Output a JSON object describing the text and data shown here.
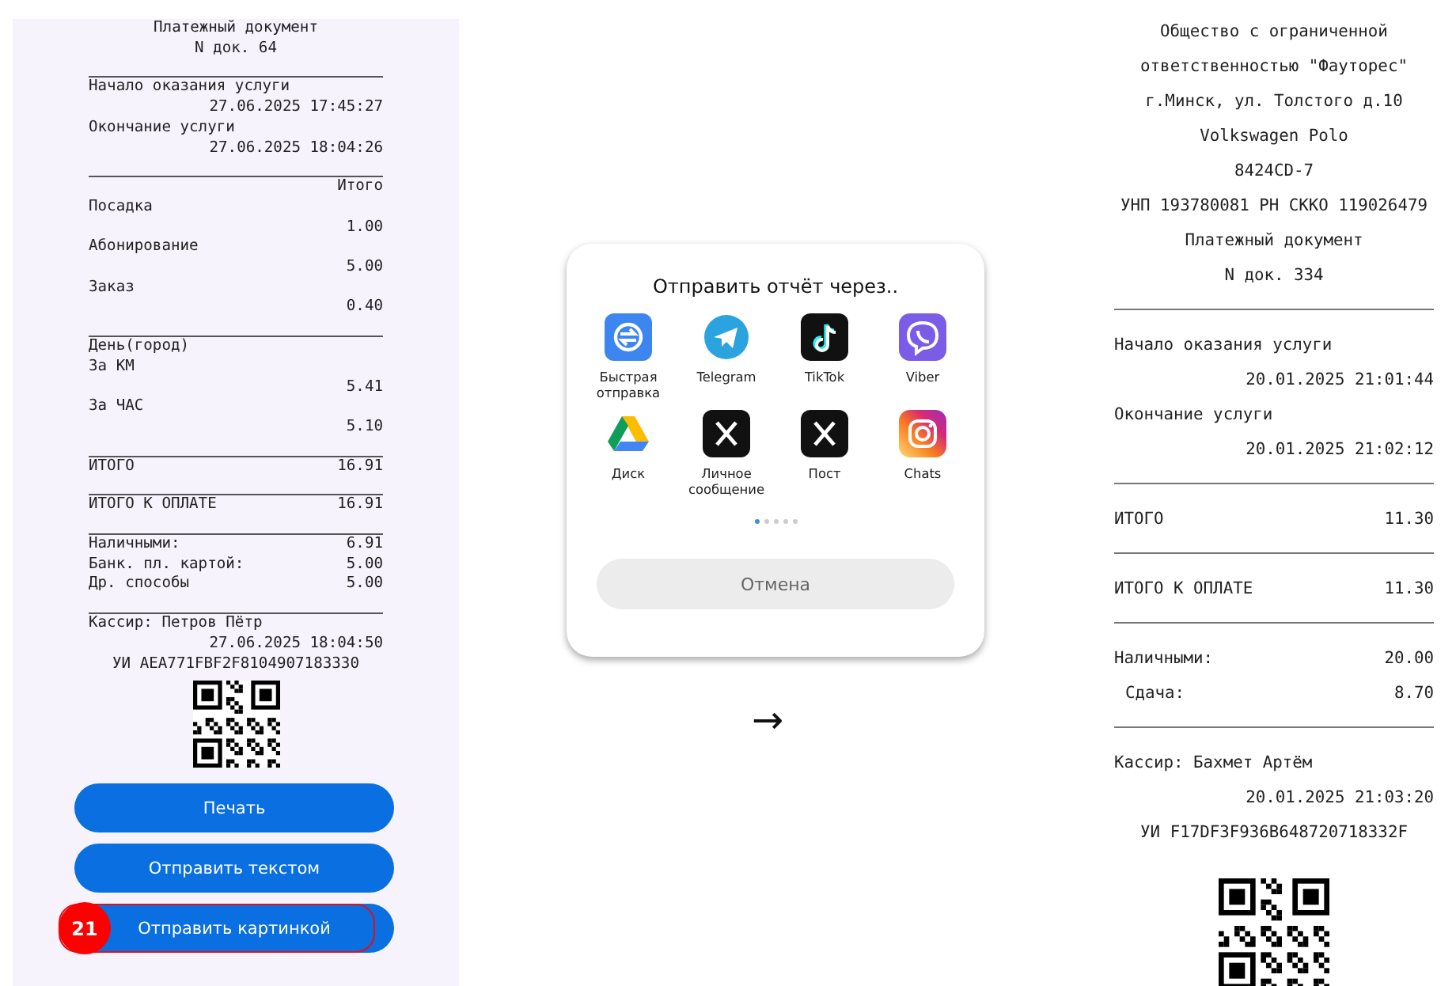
{
  "left_receipt": {
    "lines": [
      {
        "kind": "center",
        "text": "Платежный документ"
      },
      {
        "kind": "center",
        "text": "N док. 64"
      },
      {
        "kind": "rule"
      },
      {
        "kind": "left",
        "text": "Начало оказания услуги"
      },
      {
        "kind": "right",
        "text": "27.06.2025 17:45:27"
      },
      {
        "kind": "left",
        "text": "Окончание услуги"
      },
      {
        "kind": "right",
        "text": "27.06.2025 18:04:26"
      },
      {
        "kind": "rule"
      },
      {
        "kind": "right",
        "text": "Итого"
      },
      {
        "kind": "left",
        "text": "Посадка"
      },
      {
        "kind": "right",
        "text": "1.00"
      },
      {
        "kind": "left",
        "text": "Абонирование"
      },
      {
        "kind": "right",
        "text": "5.00"
      },
      {
        "kind": "left",
        "text": "Заказ"
      },
      {
        "kind": "right",
        "text": "0.40"
      },
      {
        "kind": "rule"
      },
      {
        "kind": "left",
        "text": "День(город)"
      },
      {
        "kind": "left",
        "text": "За КМ"
      },
      {
        "kind": "right",
        "text": "5.41"
      },
      {
        "kind": "left",
        "text": "За ЧАС"
      },
      {
        "kind": "right",
        "text": "5.10"
      },
      {
        "kind": "rule"
      },
      {
        "kind": "pair",
        "text": "ИТОГО",
        "value": "16.91"
      },
      {
        "kind": "rule"
      },
      {
        "kind": "pair",
        "text": "ИТОГО К ОПЛАТЕ",
        "value": "16.91"
      },
      {
        "kind": "rule"
      },
      {
        "kind": "pair",
        "text": "Наличными:",
        "value": "6.91"
      },
      {
        "kind": "pair",
        "text": "Банк. пл. картой:",
        "value": "5.00"
      },
      {
        "kind": "pair",
        "text": "Др. способы",
        "value": "5.00"
      },
      {
        "kind": "rule"
      },
      {
        "kind": "left",
        "text": "Кассир: Петров Пётр"
      },
      {
        "kind": "right",
        "text": "27.06.2025 18:04:50"
      },
      {
        "kind": "center",
        "text": "УИ AEA771FBF2F8104907183330"
      },
      {
        "kind": "qr"
      }
    ],
    "buttons": [
      {
        "label": "Печать",
        "highlighted": false
      },
      {
        "label": "Отправить текстом",
        "highlighted": false
      },
      {
        "label": "Отправить картинкой",
        "highlighted": true,
        "badge": "21"
      }
    ]
  },
  "share_sheet": {
    "title": "Отправить отчёт через..",
    "apps": [
      {
        "label": "Быстрая отправка"
      },
      {
        "label": "Telegram"
      },
      {
        "label": "TikTok"
      },
      {
        "label": "Viber"
      },
      {
        "label": "Диск"
      },
      {
        "label": "Личное сообщение"
      },
      {
        "label": "Пост"
      },
      {
        "label": "Chats"
      }
    ],
    "pages": [
      {
        "selected": true
      },
      {
        "selected": false
      },
      {
        "selected": false
      },
      {
        "selected": false
      },
      {
        "selected": false
      }
    ],
    "cancel": "Отмена"
  },
  "arrow": "→",
  "right_receipt": {
    "lines": [
      {
        "kind": "center",
        "text": "Общество с ограниченной"
      },
      {
        "kind": "center",
        "text": "ответственностью \"Фауторес\""
      },
      {
        "kind": "center",
        "text": "г.Минск, ул. Толстого д.10"
      },
      {
        "kind": "center",
        "text": "Volkswagen Polo"
      },
      {
        "kind": "center",
        "text": "8424CD-7"
      },
      {
        "kind": "center",
        "text": "УНП 193780081 РН СККО 119026479"
      },
      {
        "kind": "center",
        "text": "Платежный документ"
      },
      {
        "kind": "center",
        "text": "N док. 334"
      },
      {
        "kind": "rule"
      },
      {
        "kind": "left",
        "text": "Начало оказания услуги"
      },
      {
        "kind": "right",
        "text": "20.01.2025 21:01:44"
      },
      {
        "kind": "left",
        "text": "Окончание услуги"
      },
      {
        "kind": "right",
        "text": "20.01.2025 21:02:12"
      },
      {
        "kind": "rule"
      },
      {
        "kind": "pair",
        "text": "ИТОГО",
        "value": "11.30"
      },
      {
        "kind": "rule"
      },
      {
        "kind": "pair",
        "text": "ИТОГО К ОПЛАТЕ",
        "value": "11.30"
      },
      {
        "kind": "rule"
      },
      {
        "kind": "pair",
        "text": "Наличными:",
        "value": "20.00"
      },
      {
        "kind": "subpair",
        "text": "Сдача:",
        "value": "8.70"
      },
      {
        "kind": "rule"
      },
      {
        "kind": "left",
        "text": "Кассир: Бахмет Артём"
      },
      {
        "kind": "right",
        "text": "20.01.2025 21:03:20"
      },
      {
        "kind": "center",
        "text": "УИ F17DF3F936B648720718332F"
      },
      {
        "kind": "qr"
      }
    ]
  }
}
